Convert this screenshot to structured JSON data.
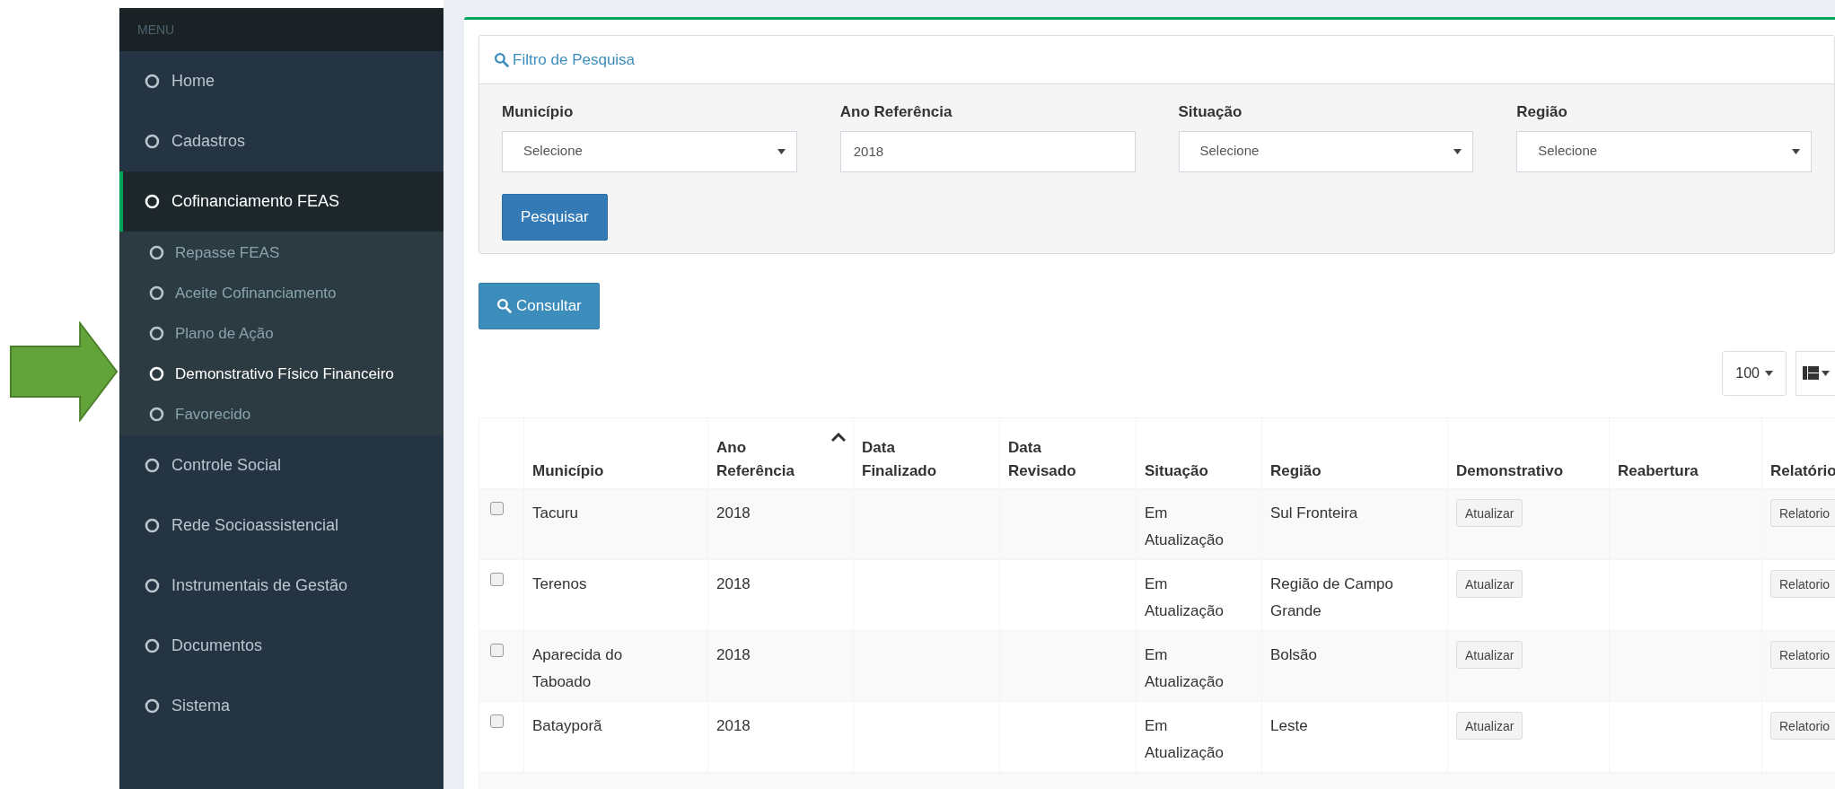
{
  "sidebar": {
    "header": "MENU",
    "items": [
      {
        "label": "Home",
        "selected": false
      },
      {
        "label": "Cadastros",
        "selected": false
      },
      {
        "label": "Cofinanciamento FEAS",
        "selected": true,
        "expanded": true,
        "children": [
          {
            "label": "Repasse FEAS",
            "selected": false
          },
          {
            "label": "Aceite Cofinanciamento",
            "selected": false
          },
          {
            "label": "Plano de Ação",
            "selected": false
          },
          {
            "label": "Demonstrativo Físico Financeiro",
            "selected": true
          },
          {
            "label": "Favorecido",
            "selected": false
          }
        ]
      },
      {
        "label": "Controle Social",
        "selected": false
      },
      {
        "label": "Rede Socioassistencial",
        "selected": false
      },
      {
        "label": "Instrumentais de Gestão",
        "selected": false
      },
      {
        "label": "Documentos",
        "selected": false
      },
      {
        "label": "Sistema",
        "selected": false
      }
    ]
  },
  "filter": {
    "title": "Filtro de Pesquisa",
    "fields": [
      {
        "label": "Município",
        "kind": "select",
        "value": "Selecione"
      },
      {
        "label": "Ano Referência",
        "kind": "input",
        "value": "2018"
      },
      {
        "label": "Situação",
        "kind": "select",
        "value": "Selecione"
      },
      {
        "label": "Região",
        "kind": "select",
        "value": "Selecione"
      }
    ],
    "button": "Pesquisar"
  },
  "consult_button": "Consultar",
  "page_size": "100",
  "table": {
    "columns": [
      {
        "label": "Município",
        "sorted": false
      },
      {
        "label": "Ano Referência",
        "sorted": true
      },
      {
        "label": "Data Finalizado",
        "sorted": false
      },
      {
        "label": "Data Revisado",
        "sorted": false
      },
      {
        "label": "Situação",
        "sorted": false
      },
      {
        "label": "Região",
        "sorted": false
      },
      {
        "label": "Demonstrativo",
        "sorted": false
      },
      {
        "label": "Reabertura",
        "sorted": false
      },
      {
        "label": "Relatório",
        "sorted": false
      }
    ],
    "rows": [
      {
        "checked": false,
        "municipio": "Tacuru",
        "ano": "2018",
        "situacao": "Em Atualização",
        "regiao": "Sul Fronteira",
        "demonstrativo": "Atualizar",
        "relatorio": "Relatorio"
      },
      {
        "checked": false,
        "municipio": "Terenos",
        "ano": "2018",
        "situacao": "Em Atualização",
        "regiao": "Região de Campo Grande",
        "demonstrativo": "Atualizar",
        "relatorio": "Relatorio"
      },
      {
        "checked": false,
        "municipio": "Aparecida do Taboado",
        "ano": "2018",
        "situacao": "Em Atualização",
        "regiao": "Bolsão",
        "demonstrativo": "Atualizar",
        "relatorio": "Relatorio"
      },
      {
        "checked": false,
        "municipio": "Batayporã",
        "ano": "2018",
        "situacao": "Em Atualização",
        "regiao": "Leste",
        "demonstrativo": "Atualizar",
        "relatorio": "Relatorio"
      }
    ]
  }
}
